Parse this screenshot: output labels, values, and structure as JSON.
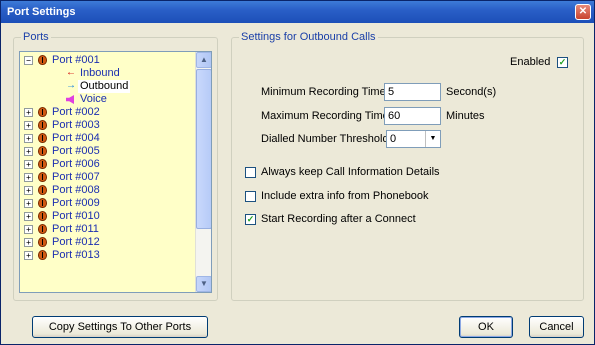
{
  "window": {
    "title": "Port Settings",
    "close_glyph": "✕"
  },
  "ports": {
    "legend": "Ports",
    "tree": [
      {
        "label": "Port #001",
        "expanded": true
      },
      {
        "label": "Inbound",
        "child": true,
        "icon": "arrow-left-icon"
      },
      {
        "label": "Outbound",
        "child": true,
        "icon": "arrow-right-icon",
        "selected": true
      },
      {
        "label": "Voice",
        "child": true,
        "icon": "speaker-icon"
      },
      {
        "label": "Port #002"
      },
      {
        "label": "Port #003"
      },
      {
        "label": "Port #004"
      },
      {
        "label": "Port #005"
      },
      {
        "label": "Port #006"
      },
      {
        "label": "Port #007"
      },
      {
        "label": "Port #008"
      },
      {
        "label": "Port #009"
      },
      {
        "label": "Port #010"
      },
      {
        "label": "Port #011"
      },
      {
        "label": "Port #012"
      },
      {
        "label": "Port #013"
      }
    ]
  },
  "settings": {
    "legend": "Settings for Outbound Calls",
    "enabled_label": "Enabled",
    "enabled": true,
    "min_recording": {
      "label": "Minimum Recording Time",
      "value": "5",
      "unit": "Second(s)"
    },
    "max_recording": {
      "label": "Maximum Recording Time",
      "value": "60",
      "unit": "Minutes"
    },
    "dialled_threshold": {
      "label": "Dialled Number Threshold",
      "value": "0"
    },
    "options": [
      {
        "label": "Always keep Call Information Details",
        "checked": false
      },
      {
        "label": "Include extra info from Phonebook",
        "checked": false
      },
      {
        "label": "Start Recording after a Connect",
        "checked": true
      }
    ]
  },
  "buttons": {
    "copy": "Copy Settings To Other Ports",
    "ok": "OK",
    "cancel": "Cancel"
  },
  "check_glyph": "✓",
  "expander": {
    "expanded": "−",
    "collapsed": "+"
  }
}
